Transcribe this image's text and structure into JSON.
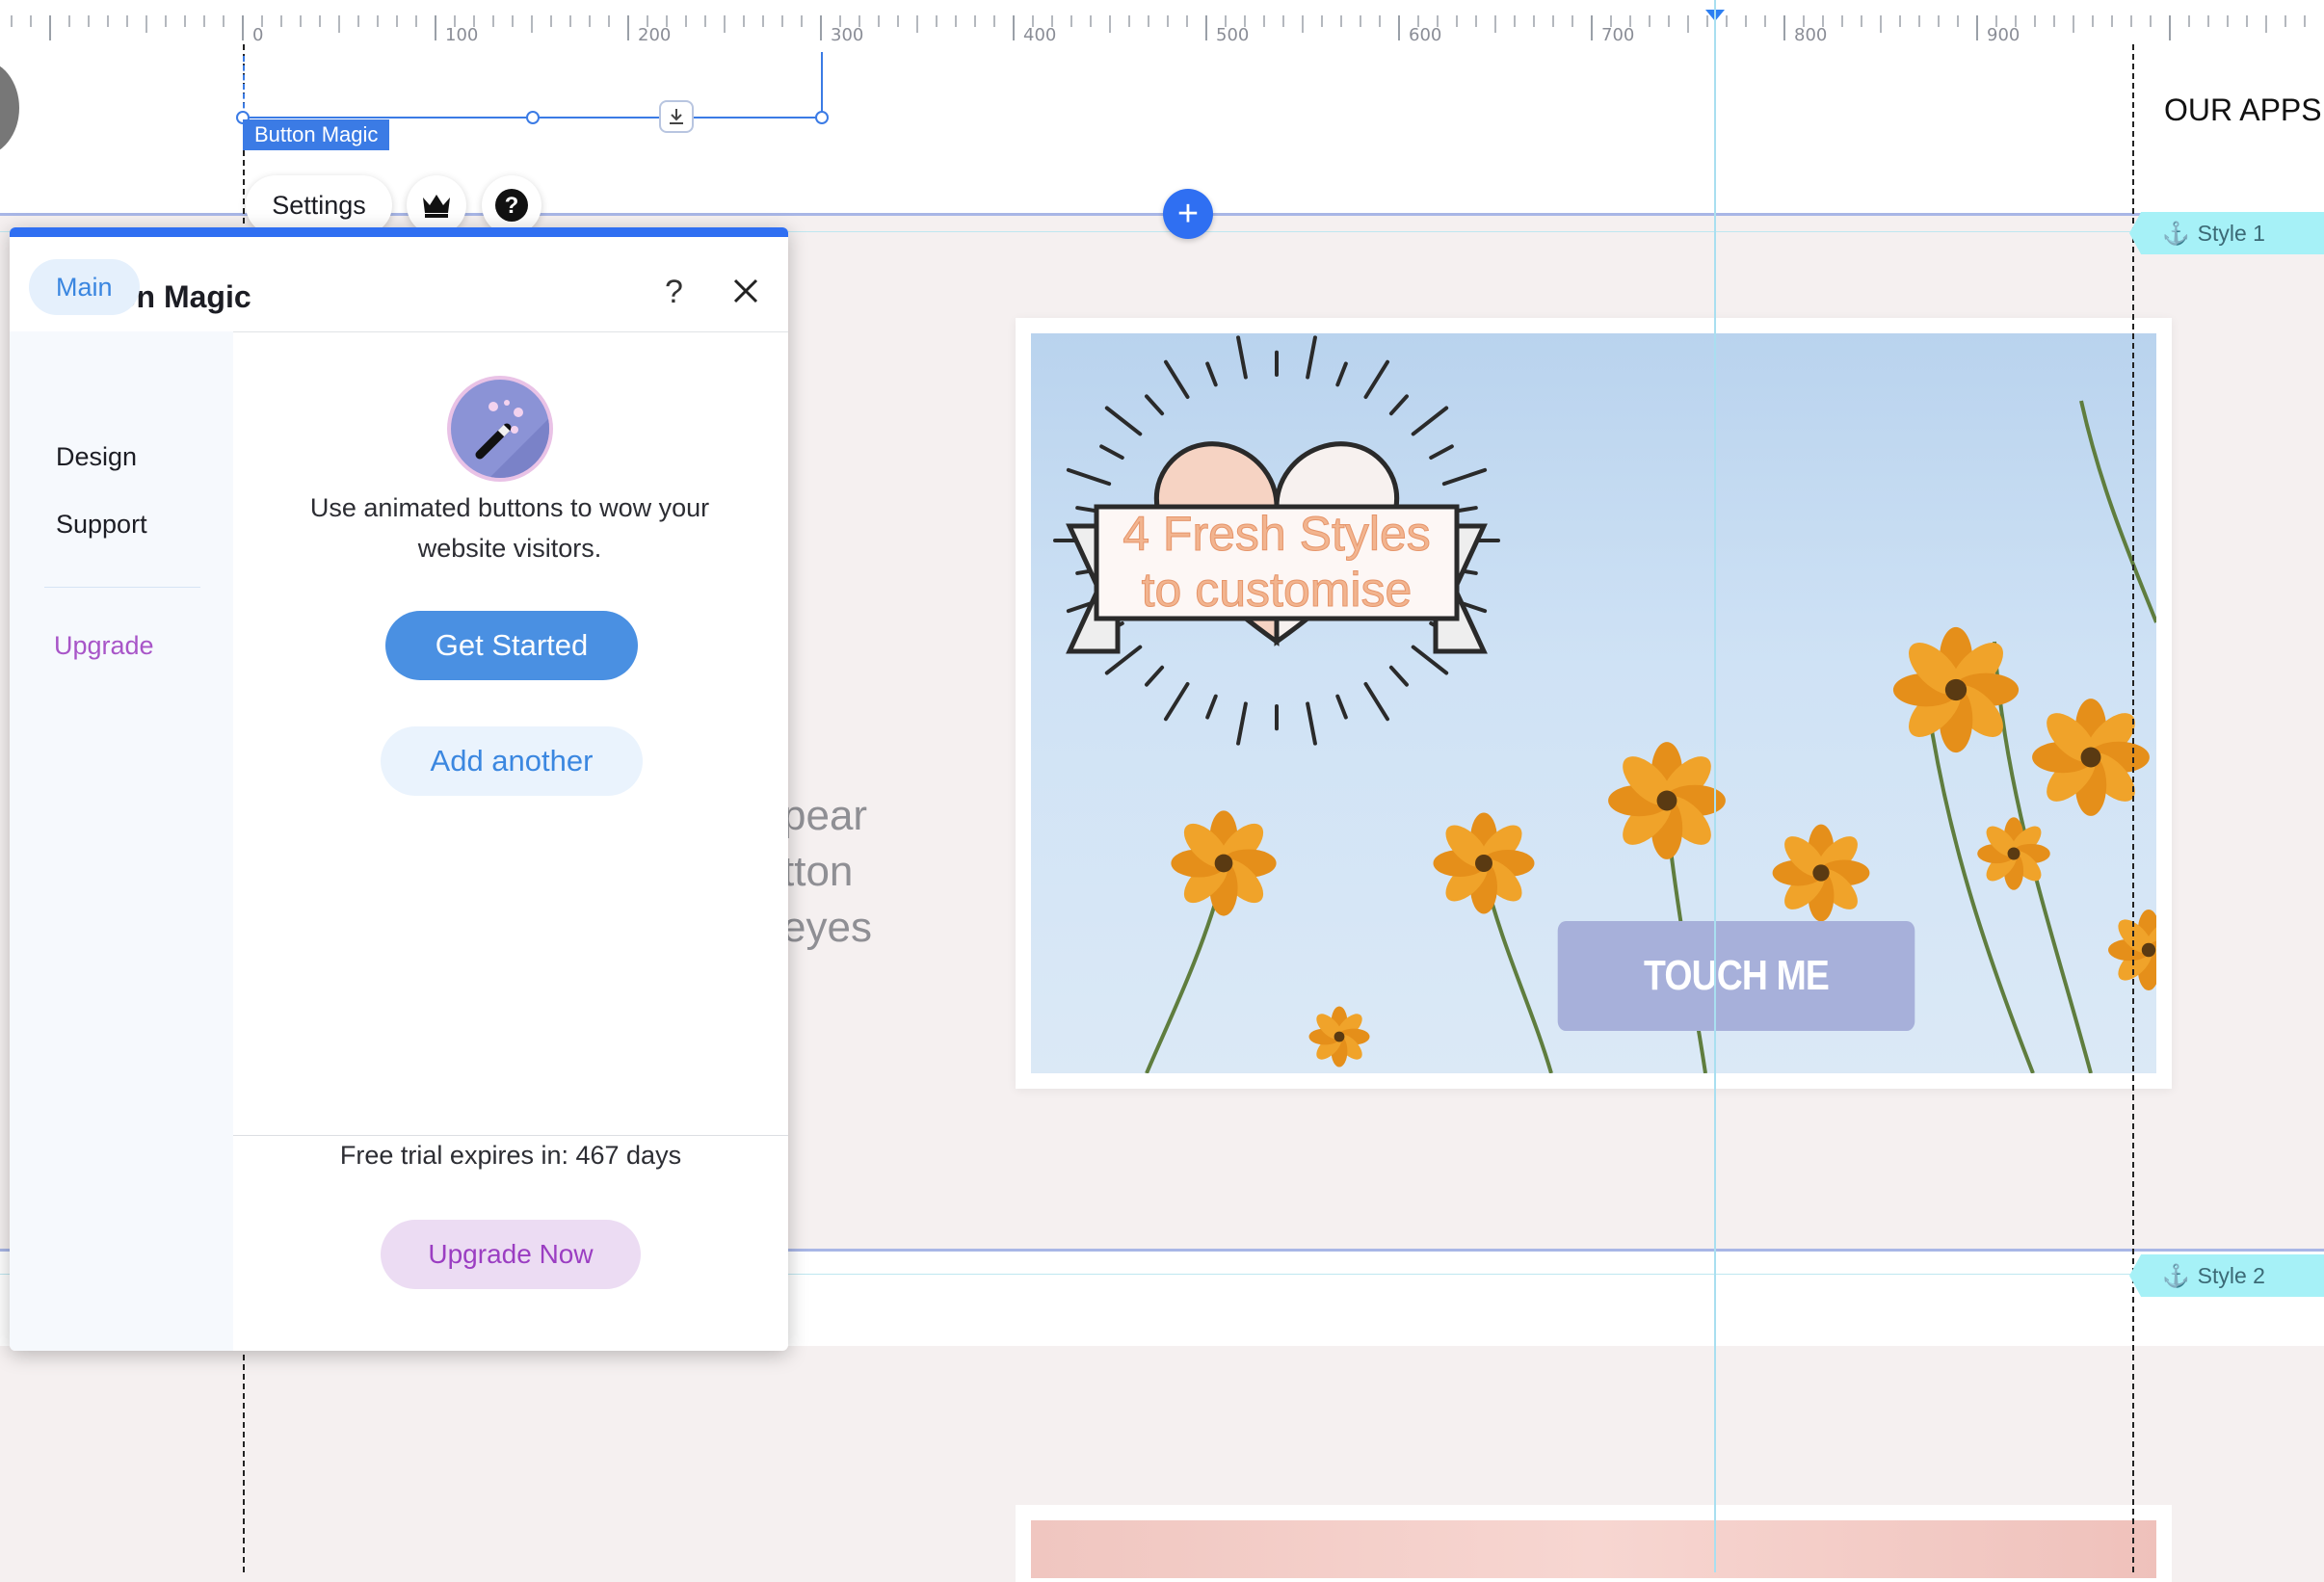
{
  "ruler": {
    "labels": [
      "0",
      "100",
      "200",
      "300",
      "400",
      "500",
      "600",
      "700",
      "800",
      "900"
    ]
  },
  "header": {
    "nav_text": "OUR APPS"
  },
  "selection": {
    "tag_label": "Button Magic"
  },
  "floating_toolbar": {
    "settings_label": "Settings",
    "crown_icon": "crown-icon",
    "help_icon": "help-icon"
  },
  "add_section": {
    "label": "+"
  },
  "anchors": [
    {
      "label": "Style 1"
    },
    {
      "label": "Style 2"
    }
  ],
  "canvas": {
    "bg_text_lines": [
      "pear",
      "tton",
      "eyes"
    ],
    "banner_text_line1": "4 Fresh Styles",
    "banner_text_line2": "to customise",
    "demo_button_label": "TOUCH ME"
  },
  "panel": {
    "title": "Button Magic",
    "help_label": "?",
    "nav": {
      "main": "Main",
      "design": "Design",
      "support": "Support",
      "upgrade": "Upgrade"
    },
    "description": "Use animated buttons to wow your website visitors.",
    "get_started_label": "Get Started",
    "add_another_label": "Add another",
    "trial_text": "Free trial expires in: 467 days",
    "upgrade_now_label": "Upgrade Now"
  },
  "colors": {
    "accent_blue": "#2f6ff2",
    "primary_button": "#4a90e2",
    "upgrade_purple": "#9b3ec2",
    "anchor_cyan": "#a6f1f7",
    "demo_button": "#a7b0da"
  }
}
